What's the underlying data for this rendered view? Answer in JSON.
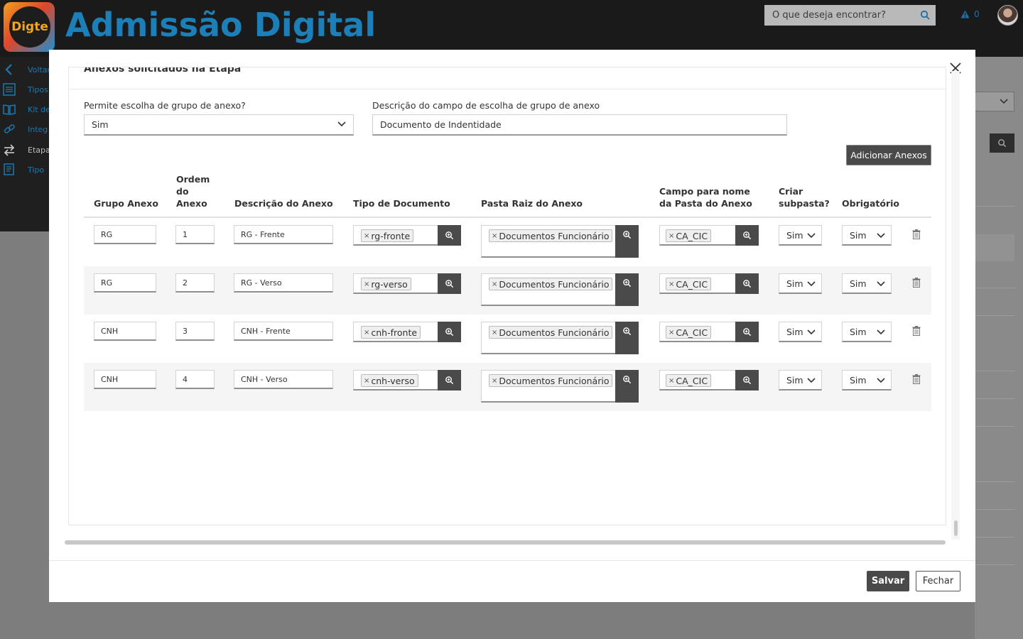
{
  "header": {
    "logo_text": "Digte",
    "app_title": "Admissão Digital",
    "search_placeholder": "O que deseja encontrar?",
    "alert_count": "0"
  },
  "sidebar": {
    "items": [
      {
        "label": "Voltar",
        "icon": "chevron-left-icon"
      },
      {
        "label": "Tipos",
        "icon": "list-icon"
      },
      {
        "label": "Kit de",
        "icon": "book-icon"
      },
      {
        "label": "Integ",
        "icon": "link-icon"
      },
      {
        "label": "Etapa",
        "icon": "arrows-icon"
      },
      {
        "label": "Tipo",
        "icon": "document-icon"
      }
    ]
  },
  "modal": {
    "section_title": "Anexos solicitados na Etapa",
    "group_choice_label": "Permite escolha de grupo de anexo?",
    "group_choice_value": "Sim",
    "group_desc_label": "Descrição do campo de escolha de grupo de anexo",
    "group_desc_value": "Documento de Indentidade",
    "add_button": "Adicionar Anexos",
    "columns": {
      "grupo": "Grupo Anexo",
      "ordem": "Ordem do Anexo",
      "descricao": "Descrição do Anexo",
      "tipo": "Tipo de Documento",
      "pasta": "Pasta Raiz do Anexo",
      "campo": "Campo para nome da Pasta do Anexo",
      "subpasta": "Criar subpasta?",
      "obrigatorio": "Obrigatório"
    },
    "rows": [
      {
        "grupo": "RG",
        "ordem": "1",
        "descricao": "RG - Frente",
        "tipo": "rg-fronte",
        "pasta": "Documentos Funcionário",
        "campo": "CA_CIC",
        "subpasta": "Sim",
        "obrigatorio": "Sim"
      },
      {
        "grupo": "RG",
        "ordem": "2",
        "descricao": "RG - Verso",
        "tipo": "rg-verso",
        "pasta": "Documentos Funcionário",
        "campo": "CA_CIC",
        "subpasta": "Sim",
        "obrigatorio": "Sim"
      },
      {
        "grupo": "CNH",
        "ordem": "3",
        "descricao": "CNH - Frente",
        "tipo": "cnh-fronte",
        "pasta": "Documentos Funcionário",
        "campo": "CA_CIC",
        "subpasta": "Sim",
        "obrigatorio": "Sim"
      },
      {
        "grupo": "CNH",
        "ordem": "4",
        "descricao": "CNH - Verso",
        "tipo": "cnh-verso",
        "pasta": "Documentos Funcionário",
        "campo": "CA_CIC",
        "subpasta": "Sim",
        "obrigatorio": "Sim"
      }
    ],
    "save_button": "Salvar",
    "close_button": "Fechar"
  },
  "colors": {
    "accent": "#1c7fb7",
    "dark_button": "#4a4a4a",
    "topbar": "#1a1a1a"
  }
}
